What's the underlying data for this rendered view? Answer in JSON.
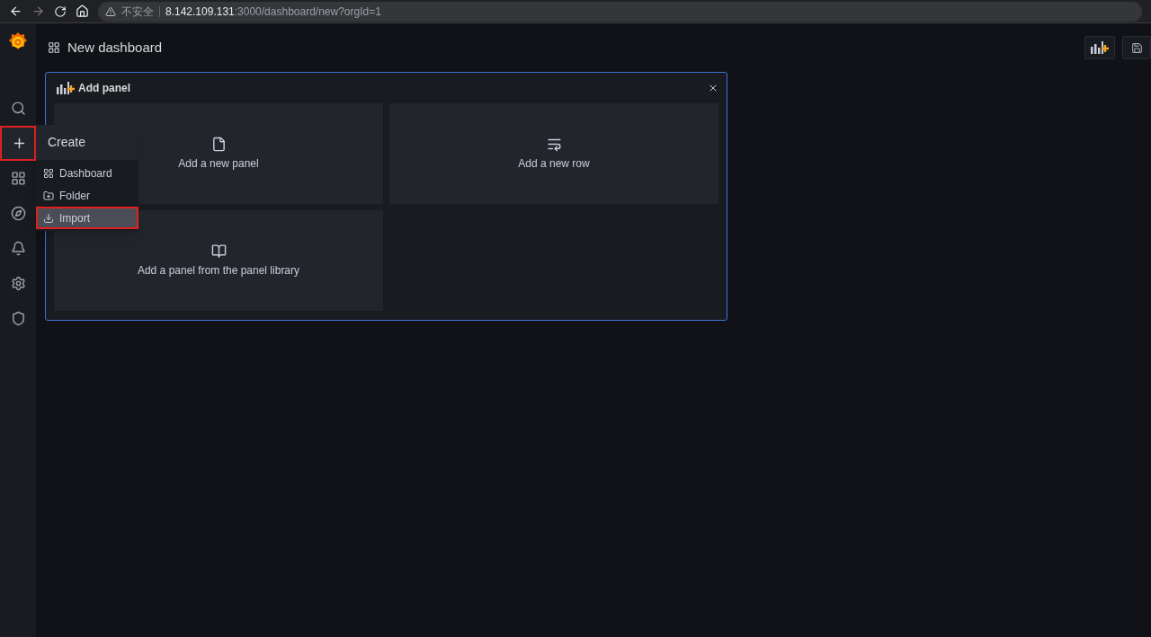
{
  "browser": {
    "security_label": "不安全",
    "url_host": "8.142.109.131",
    "url_path": ":3000/dashboard/new?orgId=1"
  },
  "sidebar": {
    "items": [
      {
        "kind": "search",
        "selected": false,
        "highlighted": false
      },
      {
        "kind": "create",
        "selected": true,
        "highlighted": true
      },
      {
        "kind": "dashboards",
        "selected": false,
        "highlighted": false
      },
      {
        "kind": "explore",
        "selected": false,
        "highlighted": false
      },
      {
        "kind": "alerting",
        "selected": false,
        "highlighted": false
      },
      {
        "kind": "configuration",
        "selected": false,
        "highlighted": false
      },
      {
        "kind": "admin",
        "selected": false,
        "highlighted": false
      }
    ]
  },
  "create_menu": {
    "title": "Create",
    "items": [
      {
        "kind": "dashboard",
        "label": "Dashboard",
        "selected": false,
        "highlighted": false
      },
      {
        "kind": "folder",
        "label": "Folder",
        "selected": false,
        "highlighted": false
      },
      {
        "kind": "import",
        "label": "Import",
        "selected": true,
        "highlighted": true
      }
    ]
  },
  "page": {
    "title": "New dashboard"
  },
  "add_panel": {
    "title": "Add panel",
    "options": [
      {
        "kind": "panel",
        "label": "Add a new panel"
      },
      {
        "kind": "row",
        "label": "Add a new row"
      },
      {
        "kind": "library",
        "label": "Add a panel from the panel library"
      }
    ]
  }
}
